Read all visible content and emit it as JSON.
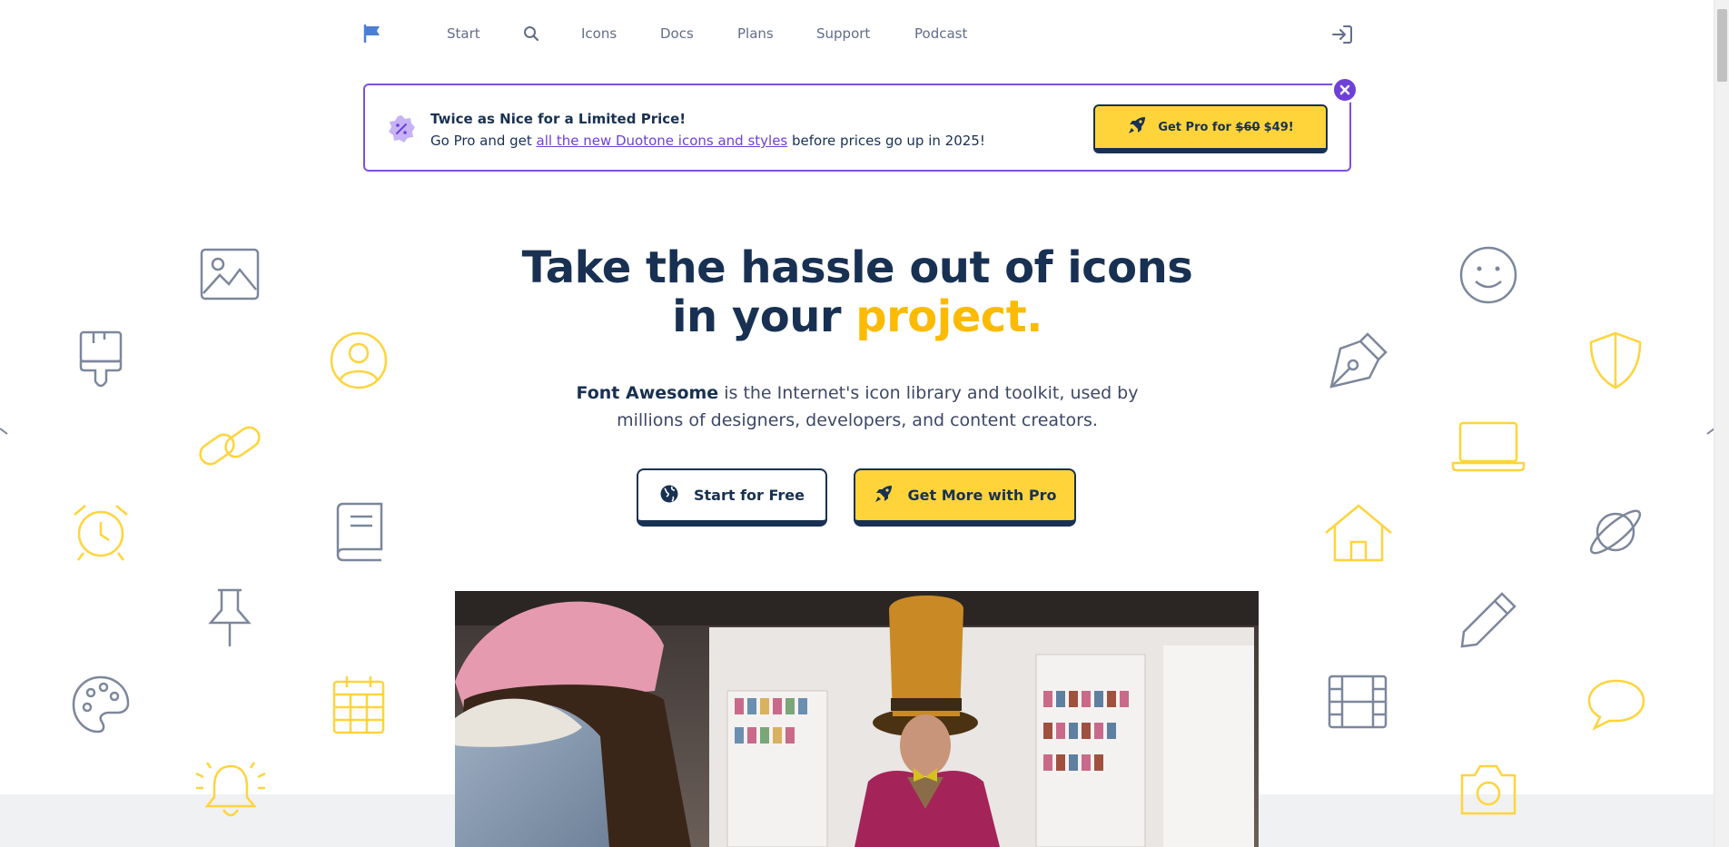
{
  "nav": {
    "logo_icon": "flag-icon",
    "items": [
      {
        "label": "Start"
      },
      {
        "label": "Icons"
      },
      {
        "label": "Docs"
      },
      {
        "label": "Plans"
      },
      {
        "label": "Support"
      },
      {
        "label": "Podcast"
      }
    ],
    "search_icon": "magnifying-glass-icon",
    "signin_icon": "right-to-bracket-icon"
  },
  "banner": {
    "title": "Twice as Nice for a Limited Price!",
    "text_before": "Go Pro and get ",
    "link_text": "all the new Duotone icons and styles",
    "text_after": " before prices go up in 2025!",
    "cta_prefix": "Get Pro for",
    "cta_old_price": "$60",
    "cta_new_price": "$49!",
    "badge_icon": "percent-badge-icon",
    "close_icon": "xmark-icon"
  },
  "hero": {
    "title_line1": "Take the hassle out of icons",
    "title_line2_plain": "in your ",
    "title_line2_accent": "project.",
    "sub_strong": "Font Awesome",
    "sub_rest": " is the Internet's icon library and toolkit, used by millions of designers, developers, and content creators.",
    "btn_free": "Start for Free",
    "btn_pro": "Get More with Pro"
  },
  "colors": {
    "navy": "#183153",
    "yellow": "#ffd43b",
    "accent_text": "#fcba03",
    "purple": "#6e40d8",
    "gray_icon": "#7c879c"
  }
}
